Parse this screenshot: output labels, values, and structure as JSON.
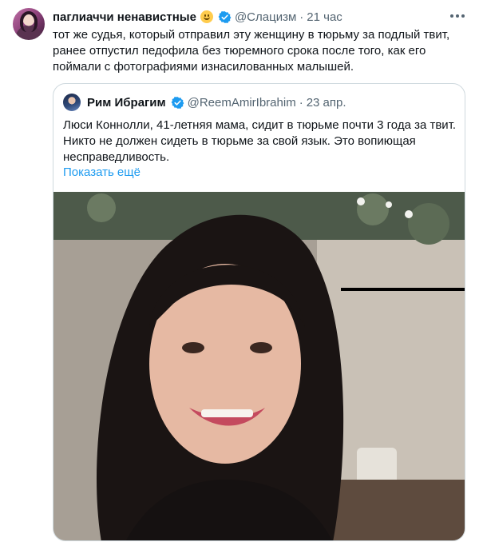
{
  "tweet": {
    "display_name": "паглиаччи ненавистные",
    "handle": "@Слацизм",
    "separator": "·",
    "time": "21 час",
    "text": "тот же судья, который отправил эту женщину в тюрьму за подлый твит, ранее отпустил педофила без тюремного срока после того, как его поймали с фотографиями изнасилованных малышей."
  },
  "quoted": {
    "display_name": "Рим Ибрагим",
    "handle": "@ReemAmirIbrahim",
    "separator": "·",
    "time": "23 апр.",
    "text": "Люси Коннолли, 41-летняя мама, сидит в тюрьме почти 3 года за твит. Никто не должен сидеть в тюрьме за свой язык. Это вопиющая несправедливость.",
    "show_more": "Показать ещё"
  },
  "icons": {
    "verified": "verified-badge-icon",
    "more": "more-options-icon"
  },
  "colors": {
    "accent": "#1d9bf0",
    "secondary_text": "#536471",
    "border": "#cfd9de"
  }
}
